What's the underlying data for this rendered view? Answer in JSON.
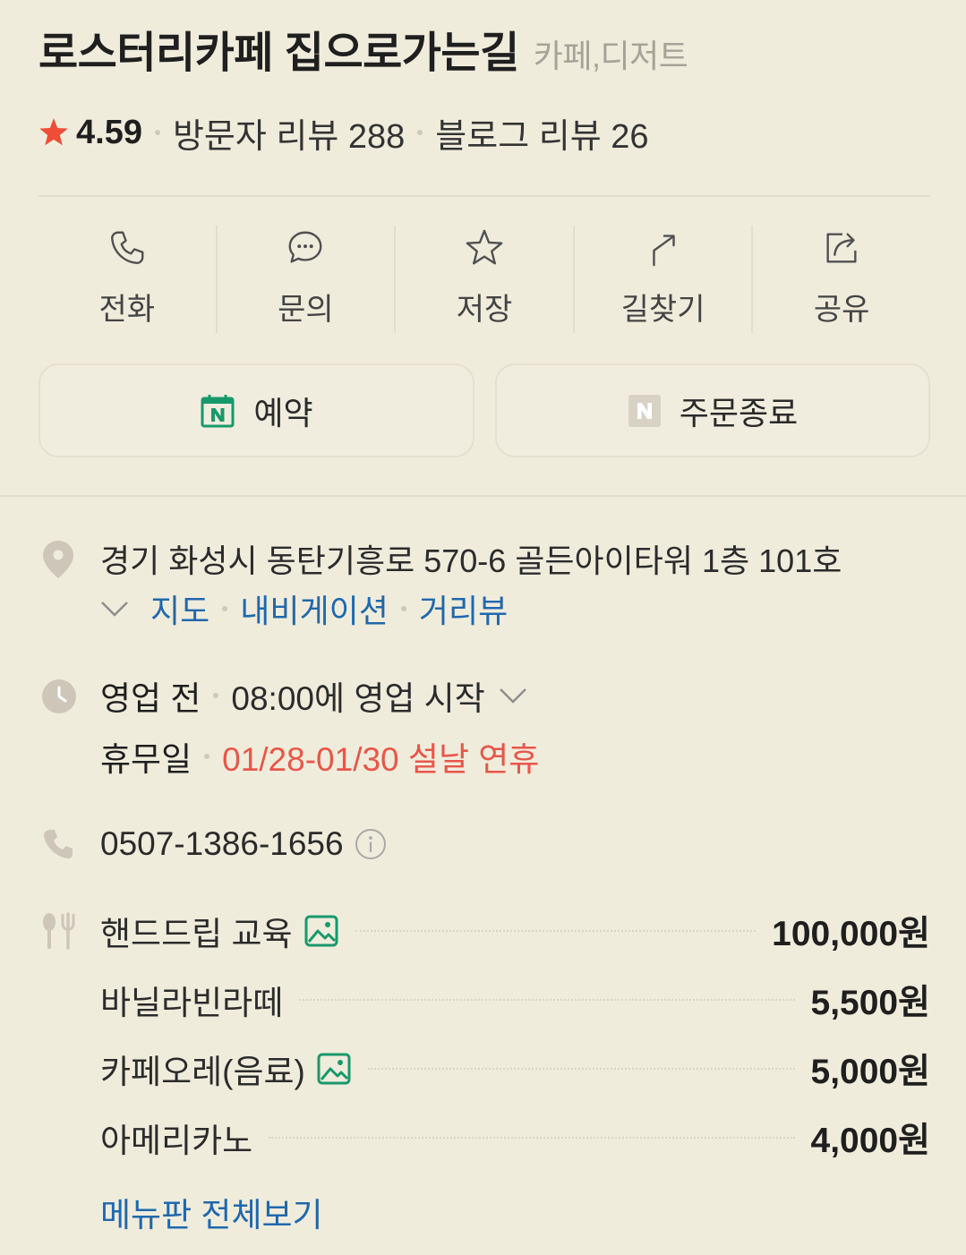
{
  "place": {
    "name": "로스터리카페 집으로가는길",
    "category": "카페,디저트",
    "rating": "4.59",
    "rating_icon": "star-filled-icon",
    "visitor_reviews": "방문자 리뷰 288",
    "blog_reviews": "블로그 리뷰 26"
  },
  "actions": [
    {
      "label": "전화",
      "icon": "phone-icon"
    },
    {
      "label": "문의",
      "icon": "chat-icon"
    },
    {
      "label": "저장",
      "icon": "star-outline-icon"
    },
    {
      "label": "길찾기",
      "icon": "directions-icon"
    },
    {
      "label": "공유",
      "icon": "share-icon"
    }
  ],
  "buttons": {
    "reserve": {
      "label": "예약",
      "icon": "naver-booking-calendar-icon"
    },
    "order": {
      "label": "주문종료",
      "icon": "naver-order-icon"
    }
  },
  "address": {
    "icon": "location-pin-icon",
    "text": "경기 화성시 동탄기흥로 570-6 골든아이타워 1층 101호",
    "expand_icon": "chevron-down-icon",
    "links": {
      "map": "지도",
      "navigation": "내비게이션",
      "street_view": "거리뷰"
    }
  },
  "hours": {
    "icon": "clock-icon",
    "status": "영업 전",
    "next_open": "08:00에 영업 시작",
    "holiday_label": "휴무일",
    "holiday_value": "01/28-01/30 설날 연휴"
  },
  "phone": {
    "icon": "phone-icon",
    "number": "0507-1386-1656",
    "info_icon": "info-icon"
  },
  "menu": {
    "icon": "cutlery-icon",
    "items": [
      {
        "name": "핸드드립 교육",
        "price": "100,000원",
        "has_photo": true
      },
      {
        "name": "바닐라빈라떼",
        "price": "5,500원",
        "has_photo": false
      },
      {
        "name": "카페오레(음료)",
        "price": "5,000원",
        "has_photo": true
      },
      {
        "name": "아메리카노",
        "price": "4,000원",
        "has_photo": false
      }
    ],
    "view_all": "메뉴판 전체보기"
  },
  "colors": {
    "background": "#F0ECDC",
    "text": "#1F1F1F",
    "category": "#A7A298",
    "link": "#2068AC",
    "holiday": "#E8564A",
    "rating_star": "#EE4D38",
    "naver_green": "#17996B",
    "info_icon": "#CDC6B9",
    "divider": "#E3DDCD",
    "action_icon": "#505050"
  }
}
